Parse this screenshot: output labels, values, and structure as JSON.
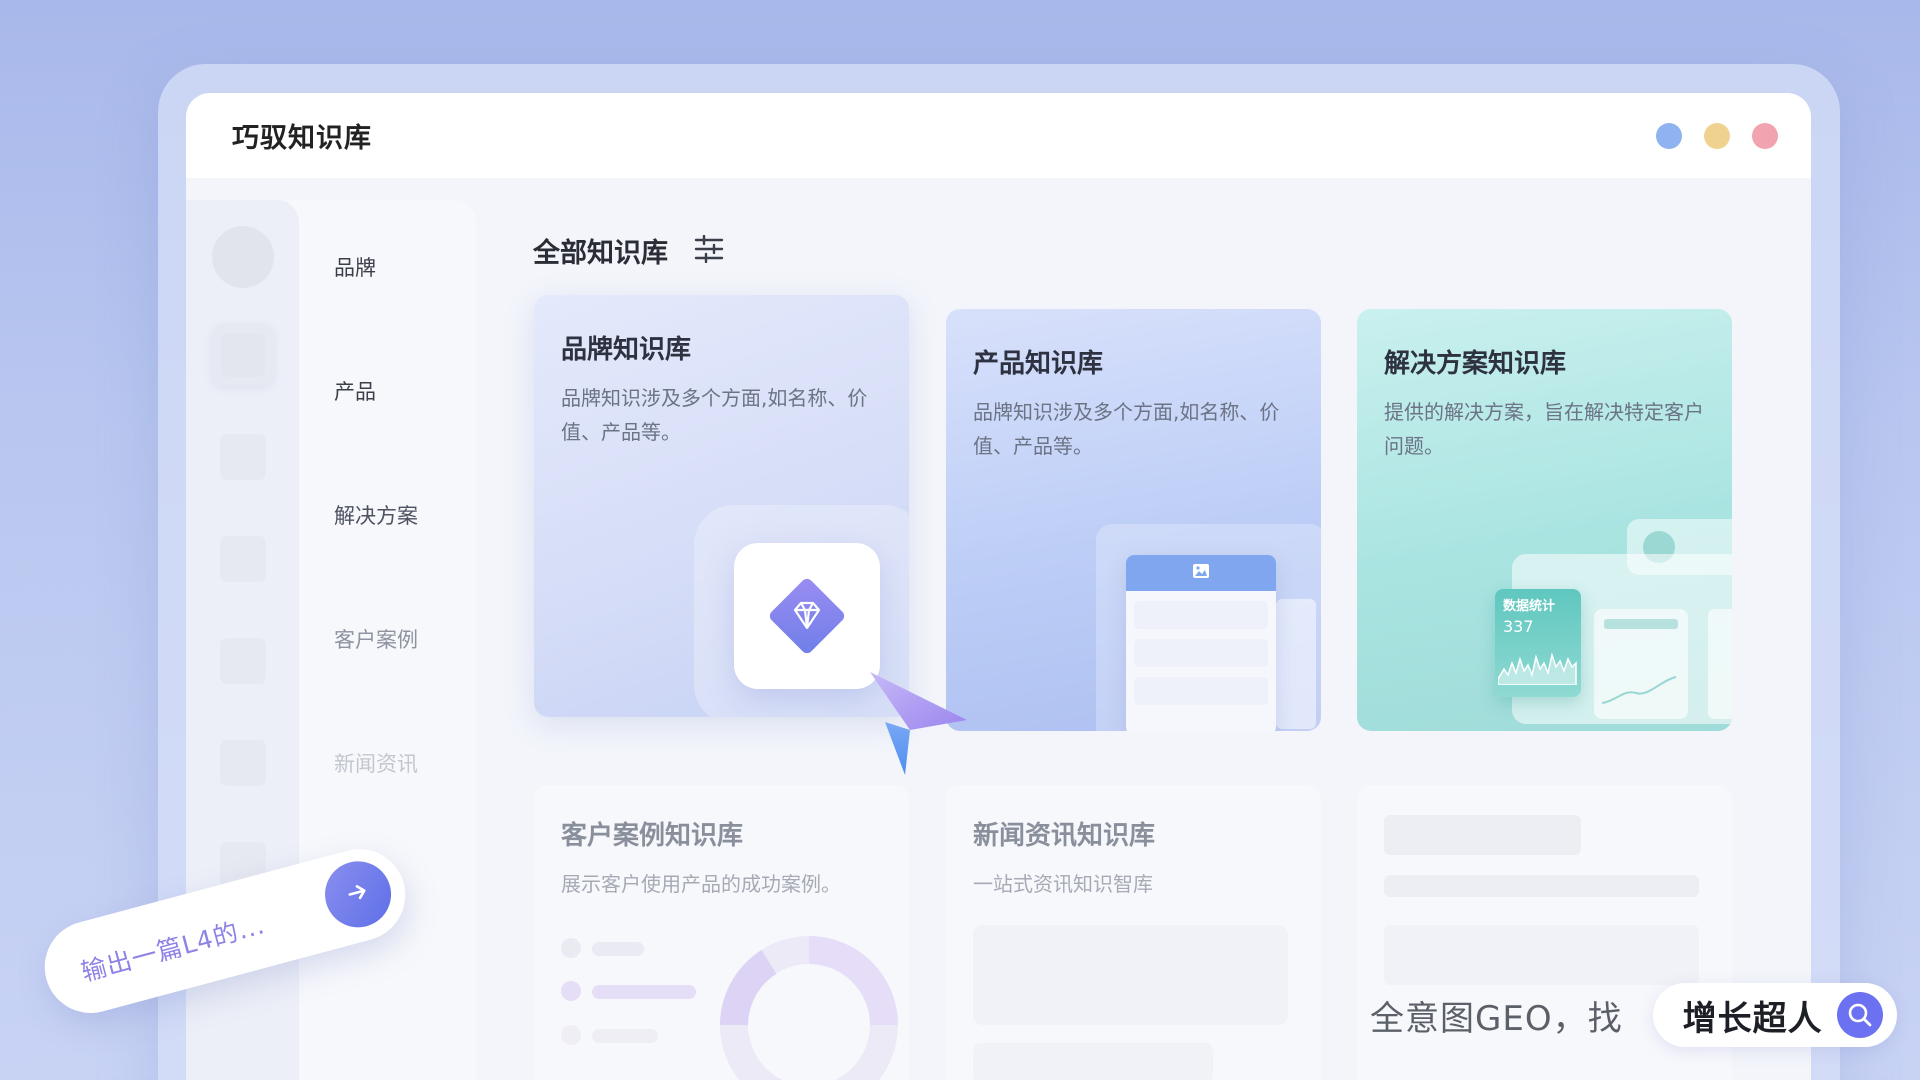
{
  "app": {
    "title": "巧驭知识库"
  },
  "window_controls": {
    "colors": [
      "#8fb3f0",
      "#efd28f",
      "#f2a3b0"
    ]
  },
  "sidebar": {
    "items": [
      {
        "label": "品牌"
      },
      {
        "label": "产品"
      },
      {
        "label": "解决方案"
      },
      {
        "label": "客户案例"
      },
      {
        "label": "新闻资讯"
      }
    ]
  },
  "main": {
    "title": "全部知识库",
    "cards": [
      {
        "title": "品牌知识库",
        "desc": "品牌知识涉及多个方面,如名称、价值、产品等。"
      },
      {
        "title": "产品知识库",
        "desc": "品牌知识涉及多个方面,如名称、价值、产品等。"
      },
      {
        "title": "解决方案知识库",
        "desc": "提供的解决方案，旨在解决特定客户问题。",
        "widget": {
          "label": "数据统计",
          "value": "337"
        }
      },
      {
        "title": "客户案例知识库",
        "desc": "展示客户使用产品的成功案例。"
      },
      {
        "title": "新闻资讯知识库",
        "desc": "一站式资讯知识智库"
      }
    ]
  },
  "prompt": {
    "text": "输出一篇L4的..."
  },
  "promo": {
    "left": "全意图GEO，找",
    "right": "增长超人"
  }
}
